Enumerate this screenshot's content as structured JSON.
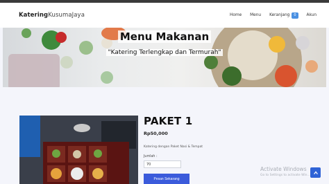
{
  "navbar": {
    "brand_bold": "Katering",
    "brand_light": "KusumaJaya",
    "items": [
      {
        "label": "Home"
      },
      {
        "label": "Menu"
      },
      {
        "label": "Keranjang",
        "badge": "0"
      },
      {
        "label": "Akun"
      }
    ]
  },
  "hero": {
    "title": "Menu Makanan",
    "subtitle": "\"Katering Terlengkap dan Termurah\""
  },
  "product": {
    "name": "PAKET 1",
    "price": "Rp50,000",
    "description": "Katering dengan Paket Nasi & Tempat",
    "qty_label": "Jumlah :",
    "qty_value": "70",
    "order_button": "Pesan Sekarang"
  },
  "windows_watermark": {
    "line1": "Activate Windows",
    "line2": "Go to Settings to activate Win..."
  },
  "colors": {
    "accent": "#3b5bdb",
    "badge": "#4a90e2",
    "background": "#f4f5fb"
  },
  "icons": {
    "scroll_top": "chevron-up-icon"
  }
}
